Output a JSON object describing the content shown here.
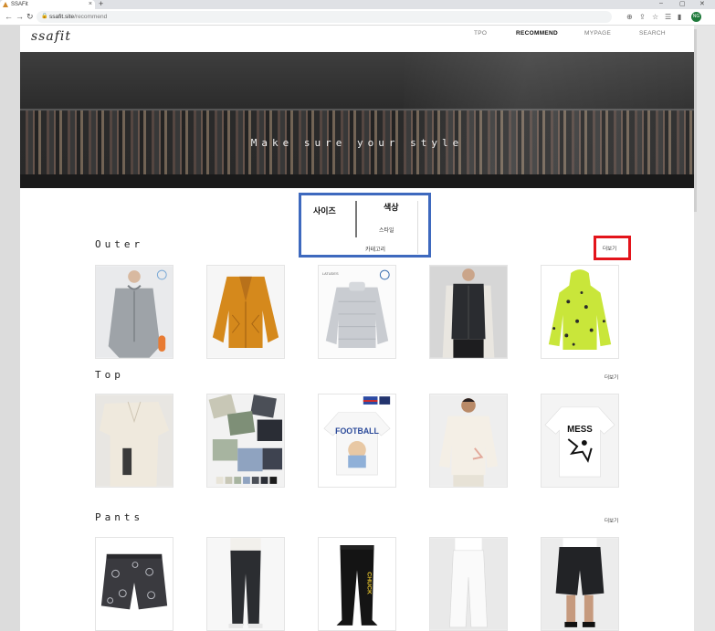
{
  "browser": {
    "tab_title": "SSAFit",
    "url_host": "ssafit.site",
    "url_path": "/recommend",
    "profile_initials": "NG"
  },
  "site": {
    "logo": "ssafit",
    "menu": [
      "TPO",
      "RECOMMEND",
      "MYPAGE",
      "SEARCH"
    ],
    "active_menu": "RECOMMEND",
    "hero_title": "Make sure your style"
  },
  "filters": {
    "tabs": [
      "사이즈",
      "색상"
    ],
    "sub_options": [
      "스타일",
      "카테고리"
    ]
  },
  "sections": [
    {
      "title": "Outer",
      "more_label": "더보기",
      "items": [
        "grey zip hoodie",
        "orange cardigan",
        "light grey puffer jacket",
        "black quilted vest",
        "neon green patterned hoodie"
      ]
    },
    {
      "title": "Top",
      "more_label": "더보기",
      "items": [
        "beige short sleeve shirt",
        "polo shirts flat lay",
        "white football graphic tee",
        "cream sweatshirt",
        "white MESS graphic tee"
      ]
    },
    {
      "title": "Pants",
      "more_label": "더보기",
      "items": [
        "paisley shorts",
        "black slim jeans",
        "black CHUCK jogger",
        "white wide pants",
        "black cargo shorts"
      ]
    }
  ],
  "colors": {
    "filter_highlight": "#3e69be",
    "more_highlight": "#e3141b"
  }
}
